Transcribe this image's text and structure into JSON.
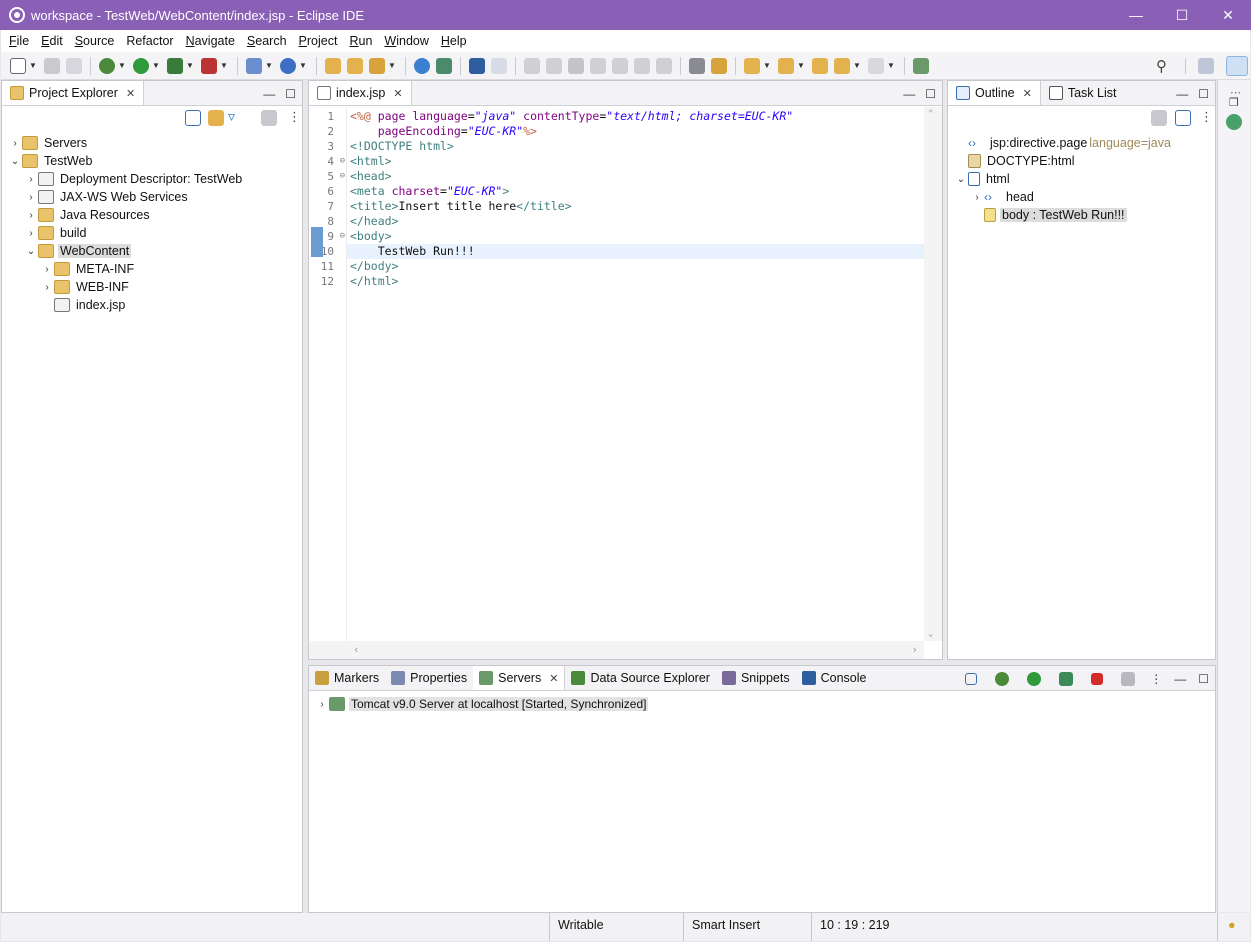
{
  "window": {
    "title": "workspace - TestWeb/WebContent/index.jsp - Eclipse IDE"
  },
  "menu": [
    {
      "label": "File",
      "u": "F",
      "rest": "ile"
    },
    {
      "label": "Edit",
      "u": "E",
      "rest": "dit"
    },
    {
      "label": "Source",
      "u": "S",
      "rest": "ource"
    },
    {
      "label": "Refactor",
      "u": "",
      "rest": "Refactor"
    },
    {
      "label": "Navigate",
      "u": "N",
      "rest": "avigate"
    },
    {
      "label": "Search",
      "u": "S",
      "rest": "earch"
    },
    {
      "label": "Project",
      "u": "P",
      "rest": "roject"
    },
    {
      "label": "Run",
      "u": "R",
      "rest": "un"
    },
    {
      "label": "Window",
      "u": "W",
      "rest": "indow"
    },
    {
      "label": "Help",
      "u": "H",
      "rest": "elp"
    }
  ],
  "project_explorer": {
    "tab": "Project Explorer",
    "tree": [
      {
        "label": "Servers",
        "level": 0,
        "arrow": "›",
        "icon": "folder-server"
      },
      {
        "label": "TestWeb",
        "level": 0,
        "arrow": "⌄",
        "icon": "web-project"
      },
      {
        "label": "Deployment Descriptor: TestWeb",
        "level": 1,
        "arrow": "›",
        "icon": "descriptor"
      },
      {
        "label": "JAX-WS Web Services",
        "level": 1,
        "arrow": "›",
        "icon": "webservice"
      },
      {
        "label": "Java Resources",
        "level": 1,
        "arrow": "›",
        "icon": "java-resources"
      },
      {
        "label": "build",
        "level": 1,
        "arrow": "›",
        "icon": "folder"
      },
      {
        "label": "WebContent",
        "level": 1,
        "arrow": "⌄",
        "icon": "folder-open",
        "selected": true
      },
      {
        "label": "META-INF",
        "level": 2,
        "arrow": "›",
        "icon": "folder"
      },
      {
        "label": "WEB-INF",
        "level": 2,
        "arrow": "›",
        "icon": "folder"
      },
      {
        "label": "index.jsp",
        "level": 2,
        "arrow": "",
        "icon": "file"
      }
    ]
  },
  "editor": {
    "tab": "index.jsp",
    "lines": [
      {
        "n": "1",
        "fold": "",
        "html": "<span class='c-dir'>&lt;%@</span> <span class='c-attr'>page language</span>=<span class='c-val'>\"java\"</span> <span class='c-attr'>contentType</span>=<span class='c-val'>\"text/html; charset=EUC-KR\"</span>"
      },
      {
        "n": "2",
        "fold": "",
        "html": "    <span class='c-attr'>pageEncoding</span>=<span class='c-val'>\"EUC-KR\"</span><span class='c-dir'>%&gt;</span>"
      },
      {
        "n": "3",
        "fold": "",
        "html": "<span class='c-tag'>&lt;!DOCTYPE html&gt;</span>"
      },
      {
        "n": "4",
        "fold": "⊖",
        "html": "<span class='c-tag'>&lt;html&gt;</span>"
      },
      {
        "n": "5",
        "fold": "⊖",
        "html": "<span class='c-tag'>&lt;head&gt;</span>"
      },
      {
        "n": "6",
        "fold": "",
        "html": "<span class='c-tag'>&lt;meta</span> <span class='c-attr'>charset</span>=<span class='c-val'>\"EUC-KR\"</span><span class='c-tag'>&gt;</span>"
      },
      {
        "n": "7",
        "fold": "",
        "html": "<span class='c-tag'>&lt;title&gt;</span>Insert title here<span class='c-tag'>&lt;/title&gt;</span>"
      },
      {
        "n": "8",
        "fold": "",
        "html": "<span class='c-tag'>&lt;/head&gt;</span>"
      },
      {
        "n": "9",
        "fold": "⊖",
        "html": "<span class='c-tag'>&lt;body&gt;</span>"
      },
      {
        "n": "10",
        "fold": "",
        "html": "    TestWeb Run!!!",
        "current": true
      },
      {
        "n": "11",
        "fold": "",
        "html": "<span class='c-tag'>&lt;/body&gt;</span>"
      },
      {
        "n": "12",
        "fold": "",
        "html": "<span class='c-tag'>&lt;/html&gt;</span>"
      }
    ]
  },
  "outline": {
    "tabs": [
      "Outline",
      "Task List"
    ],
    "tree": [
      {
        "label": "jsp:directive.page",
        "extra": " language=java",
        "level": 0,
        "arrow": "",
        "icon": "tag"
      },
      {
        "label": "DOCTYPE:html",
        "extra": "",
        "level": 0,
        "arrow": "",
        "icon": "doctype"
      },
      {
        "label": "html",
        "extra": "",
        "level": 0,
        "arrow": "⌄",
        "icon": "html-element"
      },
      {
        "label": "head",
        "extra": "",
        "level": 1,
        "arrow": "›",
        "icon": "tag"
      },
      {
        "label": "body : TestWeb Run!!!",
        "extra": "",
        "level": 1,
        "arrow": "",
        "icon": "body-element",
        "selected": true
      }
    ]
  },
  "bottom": {
    "tabs": [
      "Markers",
      "Properties",
      "Servers",
      "Data Source Explorer",
      "Snippets",
      "Console"
    ],
    "active_tab": "Servers",
    "server_row": "Tomcat v9.0 Server at localhost  [Started, Synchronized]"
  },
  "status": {
    "writable": "Writable",
    "insert_mode": "Smart Insert",
    "position": "10 : 19 : 219"
  },
  "colors": {
    "titlebar": "#8a5fb6",
    "current_line": "#e8f2fe"
  }
}
